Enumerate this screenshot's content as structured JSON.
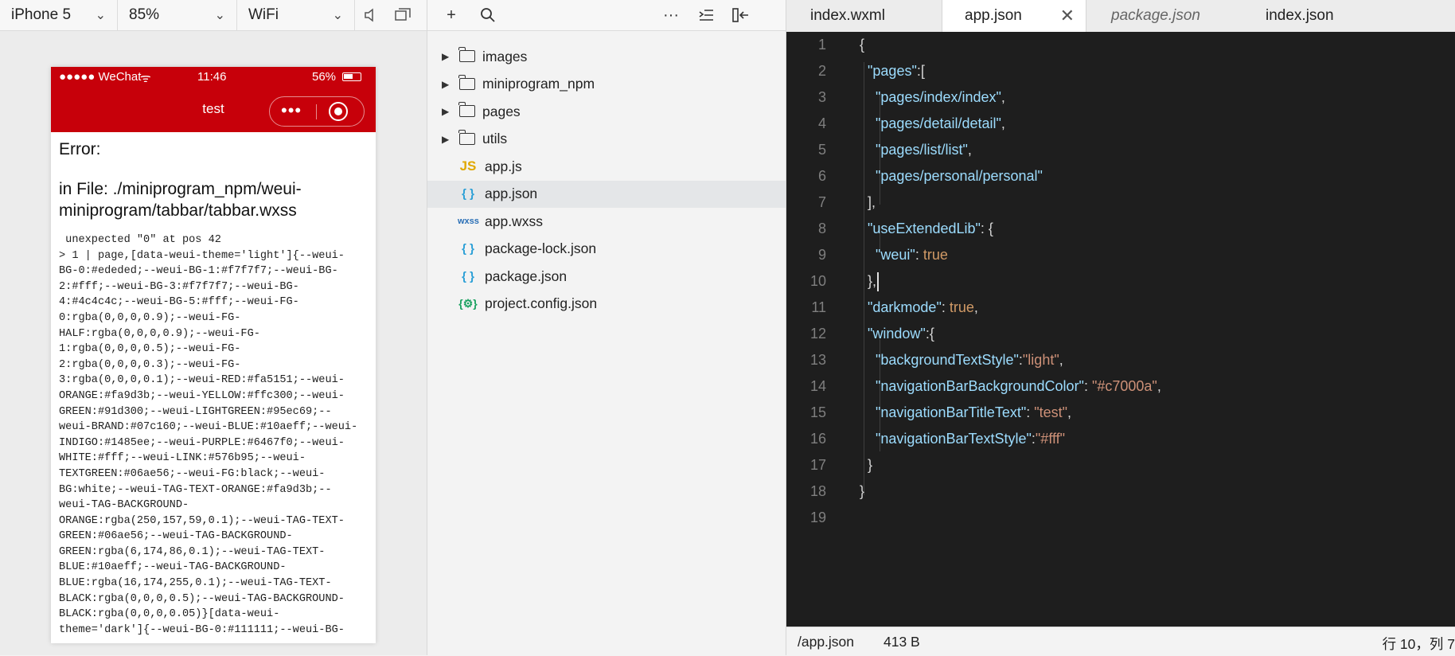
{
  "simulator": {
    "device": "iPhone 5",
    "zoom": "85%",
    "network": "WiFi",
    "status_bar": {
      "signal": "●●●●● WeChat",
      "wifi_glyph": "ᯤ",
      "time": "11:46",
      "battery": "56%"
    },
    "nav_title": "test",
    "capsule_dots": "•••",
    "error_title": "Error:",
    "error_file": "in File: ./miniprogram_npm/weui-miniprogram/tabbar/tabbar.wxss",
    "error_code": " unexpected \"0\" at pos 42\n> 1 | page,[data-weui-theme='light']{--weui-\nBG-0:#ededed;--weui-BG-1:#f7f7f7;--weui-BG-\n2:#fff;--weui-BG-3:#f7f7f7;--weui-BG-\n4:#4c4c4c;--weui-BG-5:#fff;--weui-FG-\n0:rgba(0,0,0,0.9);--weui-FG-\nHALF:rgba(0,0,0,0.9);--weui-FG-\n1:rgba(0,0,0,0.5);--weui-FG-\n2:rgba(0,0,0,0.3);--weui-FG-\n3:rgba(0,0,0,0.1);--weui-RED:#fa5151;--weui-\nORANGE:#fa9d3b;--weui-YELLOW:#ffc300;--weui-\nGREEN:#91d300;--weui-LIGHTGREEN:#95ec69;--\nweui-BRAND:#07c160;--weui-BLUE:#10aeff;--weui-\nINDIGO:#1485ee;--weui-PURPLE:#6467f0;--weui-\nWHITE:#fff;--weui-LINK:#576b95;--weui-\nTEXTGREEN:#06ae56;--weui-FG:black;--weui-\nBG:white;--weui-TAG-TEXT-ORANGE:#fa9d3b;--\nweui-TAG-BACKGROUND-\nORANGE:rgba(250,157,59,0.1);--weui-TAG-TEXT-\nGREEN:#06ae56;--weui-TAG-BACKGROUND-\nGREEN:rgba(6,174,86,0.1);--weui-TAG-TEXT-\nBLUE:#10aeff;--weui-TAG-BACKGROUND-\nBLUE:rgba(16,174,255,0.1);--weui-TAG-TEXT-\nBLACK:rgba(0,0,0,0.5);--weui-TAG-BACKGROUND-\nBLACK:rgba(0,0,0,0.05)}[data-weui-\ntheme='dark']{--weui-BG-0:#111111;--weui-BG-"
  },
  "explorer": {
    "toolbar": {
      "add": "+",
      "more": "···"
    },
    "folders": [
      "images",
      "miniprogram_npm",
      "pages",
      "utils"
    ],
    "files": [
      {
        "icon": "JS",
        "name": "app.js",
        "color": "#e0a800"
      },
      {
        "icon": "{ }",
        "name": "app.json",
        "color": "#2a9fd6",
        "selected": true
      },
      {
        "icon": "wxss",
        "name": "app.wxss",
        "color": "#2a6fb6"
      },
      {
        "icon": "{ }",
        "name": "package-lock.json",
        "color": "#2a9fd6"
      },
      {
        "icon": "{ }",
        "name": "package.json",
        "color": "#2a9fd6"
      },
      {
        "icon": "{⚙}",
        "name": "project.config.json",
        "color": "#1aa260"
      }
    ]
  },
  "editor": {
    "tabs": [
      "index.wxml",
      "app.json",
      "package.json",
      "index.json"
    ],
    "active_tab": "app.json",
    "close_glyph": "✕",
    "line_numbers": [
      "1",
      "2",
      "3",
      "4",
      "5",
      "6",
      "7",
      "8",
      "9",
      "10",
      "11",
      "12",
      "13",
      "14",
      "15",
      "16",
      "17",
      "18",
      "19"
    ],
    "status": {
      "path": "/app.json",
      "size": "413 B",
      "position": "行 10，列 7"
    }
  },
  "colors": {
    "nav": "#c7000a",
    "editor_bg": "#1e1e1e",
    "key": "#9cdcfe",
    "string": "#ce9178"
  }
}
